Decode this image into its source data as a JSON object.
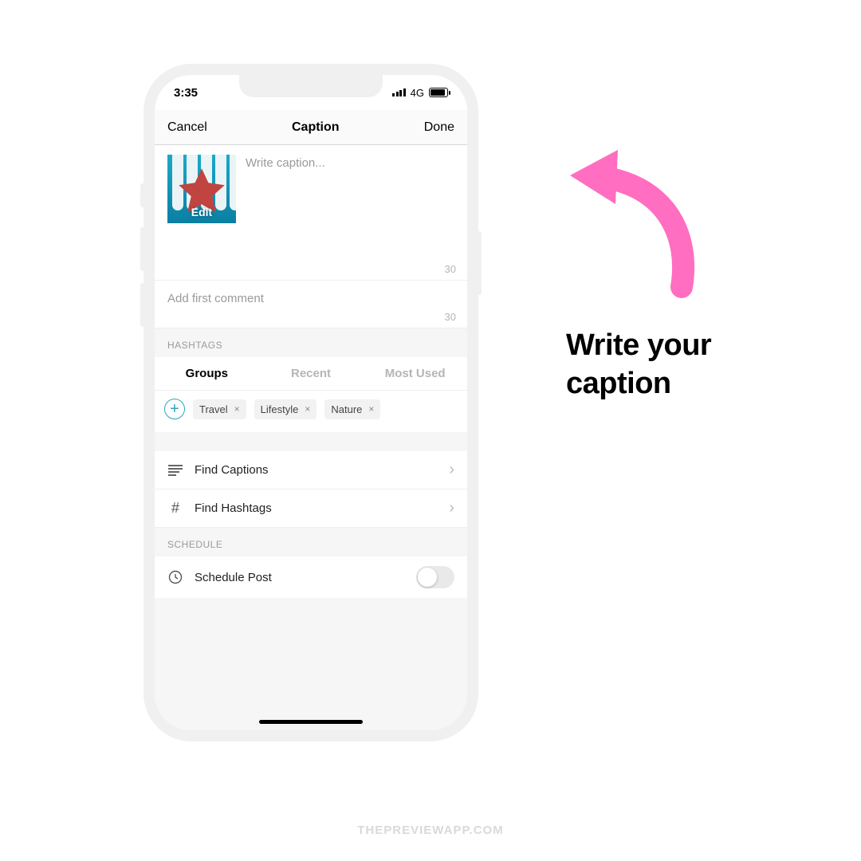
{
  "status": {
    "time": "3:35",
    "network": "4G"
  },
  "nav": {
    "cancel": "Cancel",
    "title": "Caption",
    "done": "Done"
  },
  "caption": {
    "placeholder": "Write caption...",
    "edit": "Edit",
    "counter": "30"
  },
  "comment": {
    "placeholder": "Add first comment",
    "counter": "30"
  },
  "hashtags": {
    "header": "HASHTAGS",
    "tabs": {
      "groups": "Groups",
      "recent": "Recent",
      "most_used": "Most Used"
    },
    "chips": [
      "Travel",
      "Lifestyle",
      "Nature"
    ]
  },
  "actions": {
    "find_captions": "Find Captions",
    "find_hashtags": "Find Hashtags"
  },
  "schedule": {
    "header": "SCHEDULE",
    "label": "Schedule Post"
  },
  "callout": {
    "line1": "Write your",
    "line2": "caption"
  },
  "watermark": "THEPREVIEWAPP.COM",
  "colors": {
    "accent": "#ff6ec0"
  }
}
